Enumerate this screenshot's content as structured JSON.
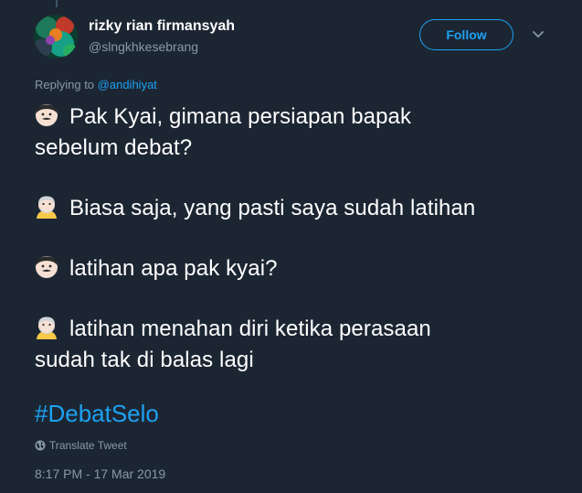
{
  "tweet": {
    "display_name": "rizky rian firmansyah",
    "handle": "@slngkhkesebrang",
    "follow_label": "Follow",
    "replying_prefix": "Replying to",
    "replying_to": "@andihiyat",
    "paragraphs": [
      {
        "emoji": "man-emoji",
        "lines": [
          "Pak Kyai, gimana persiapan bapak",
          "sebelum debat?"
        ]
      },
      {
        "emoji": "old-man-emoji",
        "lines": [
          "Biasa saja, yang pasti saya sudah latihan"
        ]
      },
      {
        "emoji": "man-emoji",
        "lines": [
          "latihan apa pak kyai?"
        ]
      },
      {
        "emoji": "old-man-emoji",
        "lines": [
          "latihan menahan diri ketika perasaan",
          "sudah tak di balas lagi"
        ]
      }
    ],
    "hashtag": "#DebatSelo",
    "translate_label": "Translate Tweet",
    "timestamp": "8:17 PM - 17 Mar 2019"
  },
  "colors": {
    "background": "#1c2633",
    "accent": "#1da1f2",
    "secondary_text": "#8899a6",
    "primary_text": "#ffffff"
  }
}
